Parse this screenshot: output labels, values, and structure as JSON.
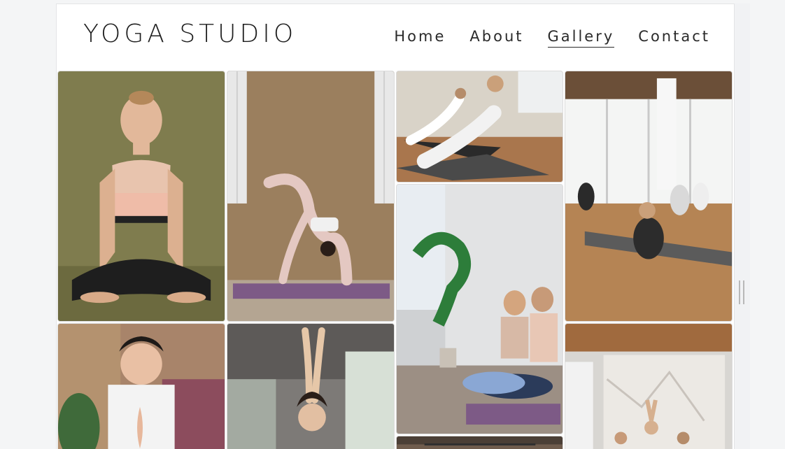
{
  "site": {
    "logo": "YOGA STUDIO"
  },
  "nav": [
    {
      "label": "Home",
      "active": false
    },
    {
      "label": "About",
      "active": false
    },
    {
      "label": "Gallery",
      "active": true
    },
    {
      "label": "Contact",
      "active": false
    }
  ],
  "colors": {
    "text": "#2a2a2a",
    "olive_backdrop": "#7f7c4e",
    "plaster_wall": "#9b7f5e",
    "wood_floor": "#a9764d",
    "purple_mat": "#7d5a86"
  },
  "gallery": [
    {
      "id": "photo-woman-lotus-olive"
    },
    {
      "id": "photo-backbend-pose"
    },
    {
      "id": "photo-cobra-pose-men"
    },
    {
      "id": "photo-studio-class-seated"
    },
    {
      "id": "photo-two-women-prayer"
    },
    {
      "id": "photo-woman-prayer-closeup"
    },
    {
      "id": "photo-arms-raised-pose"
    },
    {
      "id": "photo-studio-marble-class"
    },
    {
      "id": "photo-studio-ceiling"
    }
  ]
}
